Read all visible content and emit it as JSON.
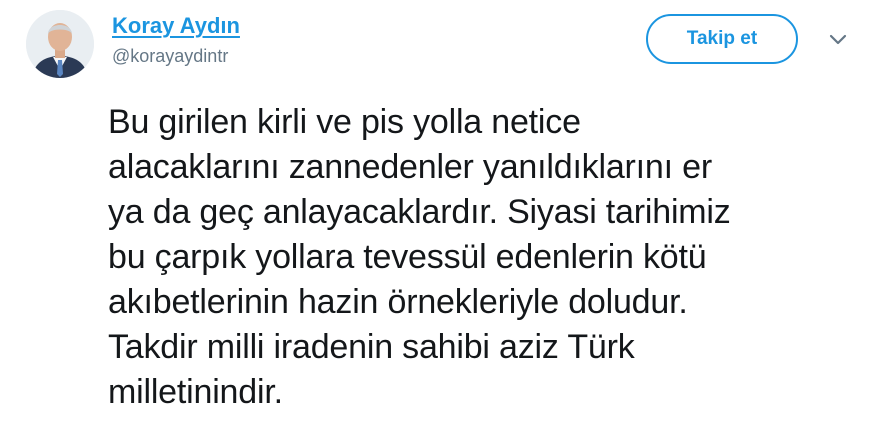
{
  "user": {
    "name": "Koray Aydın",
    "handle": "@korayaydintr"
  },
  "actions": {
    "follow_label": "Takip et",
    "more_icon": "chevron-down-icon"
  },
  "tweet": {
    "lines": [
      "Bu girilen kirli ve pis yolla netice",
      "alacaklarını zannedenler yanıldıklarını er",
      "ya da geç anlayacaklardır. Siyasi tarihimiz",
      "bu çarpık yollara tevessül edenlerin kötü",
      "akıbetlerinin hazin örnekleriyle doludur.",
      "Takdir milli iradenin sahibi aziz Türk",
      "milletinindir."
    ]
  },
  "colors": {
    "accent": "#1b95e0",
    "text": "#14171a",
    "secondary": "#657786"
  }
}
